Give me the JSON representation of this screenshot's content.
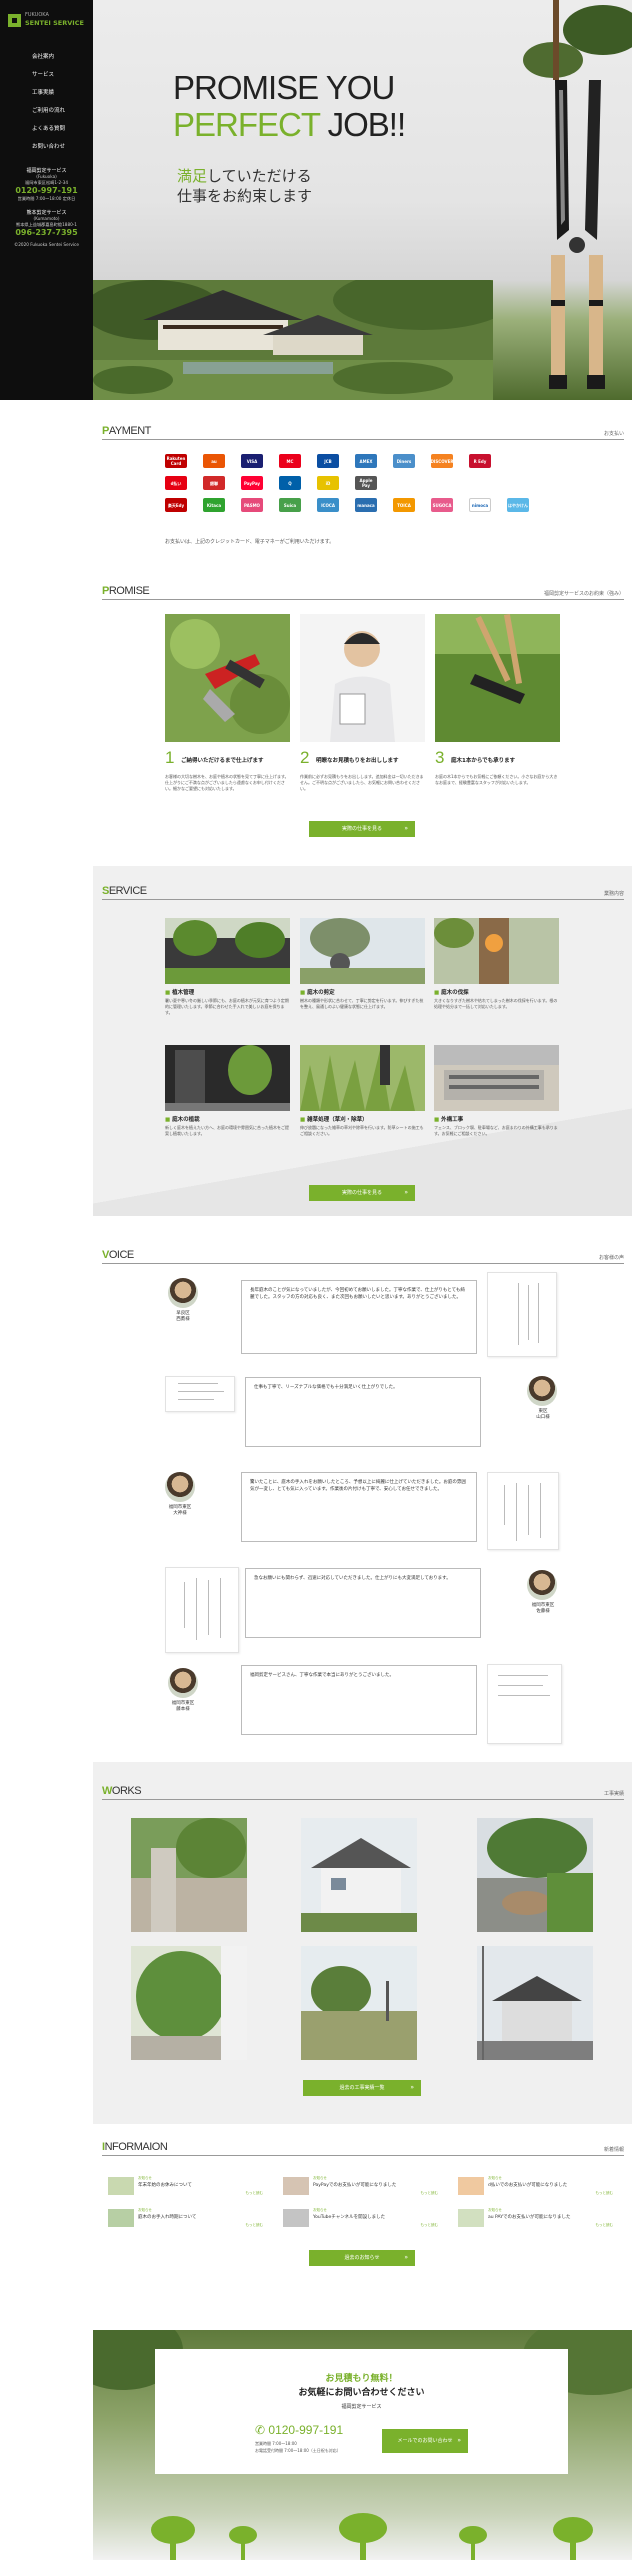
{
  "sidebar": {
    "logo_small": "FUKUOKA",
    "logo_big": "SENTEI SERVICE",
    "menu": [
      "会社案内",
      "サービス",
      "工事実績",
      "ご利用の流れ",
      "よくある質問",
      "お問い合わせ"
    ],
    "contact1_title": "福岡剪定サービス",
    "contact1_en": "(Fukuoka)",
    "contact1_addr": "福岡市東区松崎1-2-34",
    "contact1_tel": "0120-997-191",
    "contact1_hours": "営業時間 7:00〜18:00 定休日",
    "contact2_title": "熊本剪定サービス",
    "contact2_en": "(Kumamoto)",
    "contact2_addr": "熊本県上益城郡嘉島町鯰1880-1",
    "contact2_tel": "096-237-7395",
    "copyright": "©2020 Fukuoka Sentei Service"
  },
  "hero": {
    "line1": "PROMISE YOU",
    "line2_green": "PERFECT",
    "line2_black": " JOB!!",
    "sub1_green": "満足",
    "sub1": "していただける",
    "sub2": "仕事をお約束します"
  },
  "payment": {
    "title": "PAYMENT",
    "right": "お支払い",
    "logos": [
      [
        {
          "name": "Rakuten Card",
          "color": "#bf0000"
        },
        {
          "name": "au",
          "color": "#ea5504"
        },
        {
          "name": "VISA",
          "color": "#1a1f71"
        },
        {
          "name": "MC",
          "color": "#eb001b"
        },
        {
          "name": "JCB",
          "color": "#0b4ea2"
        },
        {
          "name": "AMEX",
          "color": "#2e77bb"
        },
        {
          "name": "Diners",
          "color": "#4b8fca"
        },
        {
          "name": "DISCOVER",
          "color": "#f58220"
        },
        {
          "name": "R Edy",
          "color": "#c8102e"
        }
      ],
      [
        {
          "name": "d払い",
          "color": "#e60012"
        },
        {
          "name": "銀聯",
          "color": "#d12929"
        },
        {
          "name": "PayPay",
          "color": "#ff0033"
        },
        {
          "name": "Q",
          "color": "#0060a9"
        },
        {
          "name": "iD",
          "color": "#e7c200"
        },
        {
          "name": "Apple Pay",
          "color": "#555555"
        }
      ],
      [
        {
          "name": "楽天Edy",
          "color": "#bf0000"
        },
        {
          "name": "Kitaca",
          "color": "#2fa32f"
        },
        {
          "name": "PASMO",
          "color": "#e64a7a"
        },
        {
          "name": "Suica",
          "color": "#47a04a"
        },
        {
          "name": "ICOCA",
          "color": "#3a8fc9"
        },
        {
          "name": "manaca",
          "color": "#2a6eb0"
        },
        {
          "name": "TOICA",
          "color": "#f39800"
        },
        {
          "name": "SUGOCA",
          "color": "#e85b8c"
        },
        {
          "name": "nimoca",
          "color": "#ffffff"
        },
        {
          "name": "はやかけん",
          "color": "#5bb8e8"
        }
      ]
    ],
    "note": "お支払いは、上記のクレジットカード、電子マネーがご利用いただけます。"
  },
  "promise": {
    "title": "PROMISE",
    "right": "福岡剪定サービスのお約束（強み）",
    "items": [
      {
        "num": "1",
        "title": "ご納得いただけるまで仕上げます",
        "text": "お客様の大切な樹木を、お庭や植木の状態を見て丁寧に仕上げます。仕上がりにご不満な点がございましたら遠慮なくお申し付けください。細かなご要望にも対応いたします。"
      },
      {
        "num": "2",
        "title": "明瞭なお見積もりをお出しします",
        "text": "作業前に必ずお見積もりをお出しします。追加料金は一切いただきません。ご不明な点がございましたら、お気軽にお問い合わせください。"
      },
      {
        "num": "3",
        "title": "庭木1本からでも承ります",
        "text": "お庭の木1本からでもお気軽にご依頼ください。小さなお庭から大きなお庭まで、経験豊富なスタッフが対応いたします。"
      }
    ],
    "button": "実際の仕事を見る"
  },
  "service": {
    "title": "SERVICE",
    "right": "業務内容",
    "items": [
      {
        "title": "植木管理",
        "text": "暑い夏や寒い冬の厳しい季節にも、お庭の植木が元気に育つよう定期的に管理いたします。季節に合わせた手入れで美しいお庭を保ちます。"
      },
      {
        "title": "庭木の剪定",
        "text": "樹木の種類や形状に合わせて、丁寧に剪定を行います。伸びすぎた枝を整え、風通しのよい健康な状態に仕上げます。"
      },
      {
        "title": "庭木の伐採",
        "text": "大きくなりすぎた樹木や枯れてしまった樹木の伐採を行います。根の処理や処分まで一括して対応いたします。"
      },
      {
        "title": "庭木の植栽",
        "text": "新しく庭木を植えたい方へ、お庭の環境や雰囲気に合った植木をご提案し植栽いたします。"
      },
      {
        "title": "雑草処理（草刈・除草）",
        "text": "伸び放題になった雑草の草刈や除草を行います。防草シートの施工もご相談ください。"
      },
      {
        "title": "外構工事",
        "text": "フェンス、ブロック塀、駐車場など、お庭まわりの外構工事も承ります。お気軽にご相談ください。"
      }
    ],
    "button": "実際の仕事を見る"
  },
  "voice": {
    "title": "VOICE",
    "right": "お客様の声",
    "items": [
      {
        "name": "早良区\n西鷹様",
        "text": "長年庭木のことが気になっていましたが、今回初めてお願いしました。丁寧な作業で、仕上がりもとても綺麗でした。スタッフの方の対応も良く、また次回もお願いしたいと思います。ありがとうございました。"
      },
      {
        "name": "東区\n山口様",
        "text": "仕事も丁寧で、リーズナブルな価格でも十分満足いく仕上がりでした。"
      },
      {
        "name": "福岡市東区\n大神様",
        "text": "驚いたことに、庭木の手入れをお願いしたところ、予想以上に綺麗に仕上げていただきました。お庭の雰囲気が一変し、とても気に入っています。作業後の片付けも丁寧で、安心してお任せできました。"
      },
      {
        "name": "福岡市東区\n佐藤様",
        "text": "急なお願いにも関わらず、迅速に対応していただきました。仕上がりにも大変満足しております。"
      },
      {
        "name": "福岡市東区\n藤本様",
        "text": "福岡剪定サービスさん、丁寧な作業で本当にありがとうございました。"
      }
    ]
  },
  "works": {
    "title": "WORKS",
    "right": "工事実績",
    "button": "過去の工事実績一覧"
  },
  "info": {
    "title": "INFORMAION",
    "right": "新着情報",
    "items": [
      {
        "tag": "お知らせ",
        "text": "年末年始のお休みについて",
        "more": "もっと読む"
      },
      {
        "tag": "お知らせ",
        "text": "PayPayでのお支払いが可能になりました",
        "more": "もっと読む"
      },
      {
        "tag": "お知らせ",
        "text": "d払いでのお支払いが可能になりました",
        "more": "もっと読む"
      },
      {
        "tag": "お知らせ",
        "text": "庭木のお手入れ時期について",
        "more": "もっと読む"
      },
      {
        "tag": "お知らせ",
        "text": "YouTubeチャンネルを開設しました",
        "more": "もっと読む"
      },
      {
        "tag": "お知らせ",
        "text": "au PAYでのお支払いが可能になりました",
        "more": "もっと読む"
      }
    ],
    "button": "過去のお知らせ"
  },
  "contact": {
    "heading_green": "お見積もり無料！",
    "heading2": "お気軽にお問い合わせください",
    "company": "福岡剪定サービス",
    "tel": "0120-997-191",
    "hours": "営業時間 7:00〜18:00",
    "note": "お電話受付時間 7:00〜18:00（土日祝も対応）",
    "button": "メールでのお問い合わせ"
  },
  "colors": {
    "accent": "#7ab12c",
    "dark": "#0e0e0e"
  }
}
